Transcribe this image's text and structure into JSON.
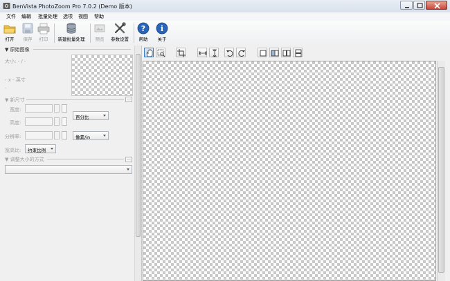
{
  "window": {
    "title": "BenVista PhotoZoom Pro 7.0.2 (Demo 版本)"
  },
  "menu": [
    "文件",
    "编辑",
    "批量处理",
    "选项",
    "视图",
    "帮助"
  ],
  "toolbar": {
    "open": "打开",
    "save": "保存",
    "print": "打印",
    "new_batch": "新建批量处理",
    "preview": "预览",
    "settings": "参数设置",
    "help": "帮助",
    "about": "关于"
  },
  "left": {
    "original_header": "▼ 原始图像",
    "size_label": "大小: - / -",
    "dims_label": "- x - 英寸",
    "dash": "-",
    "new_size_header": "▼ 新尺寸",
    "width_label": "宽度:",
    "height_label": "高度:",
    "resolution_label": "分辨率:",
    "aspect_label": "宽高比:",
    "unit_percent": "百分比",
    "unit_ppi": "像素/in",
    "aspect_value": "约束比例",
    "resize_header": "▼ 调整大小的方式",
    "more": "..."
  },
  "colors": {
    "accent": "#3d7bc7",
    "checker_dark": "#c8c8c8",
    "panel_bg": "#f0f0f0"
  }
}
